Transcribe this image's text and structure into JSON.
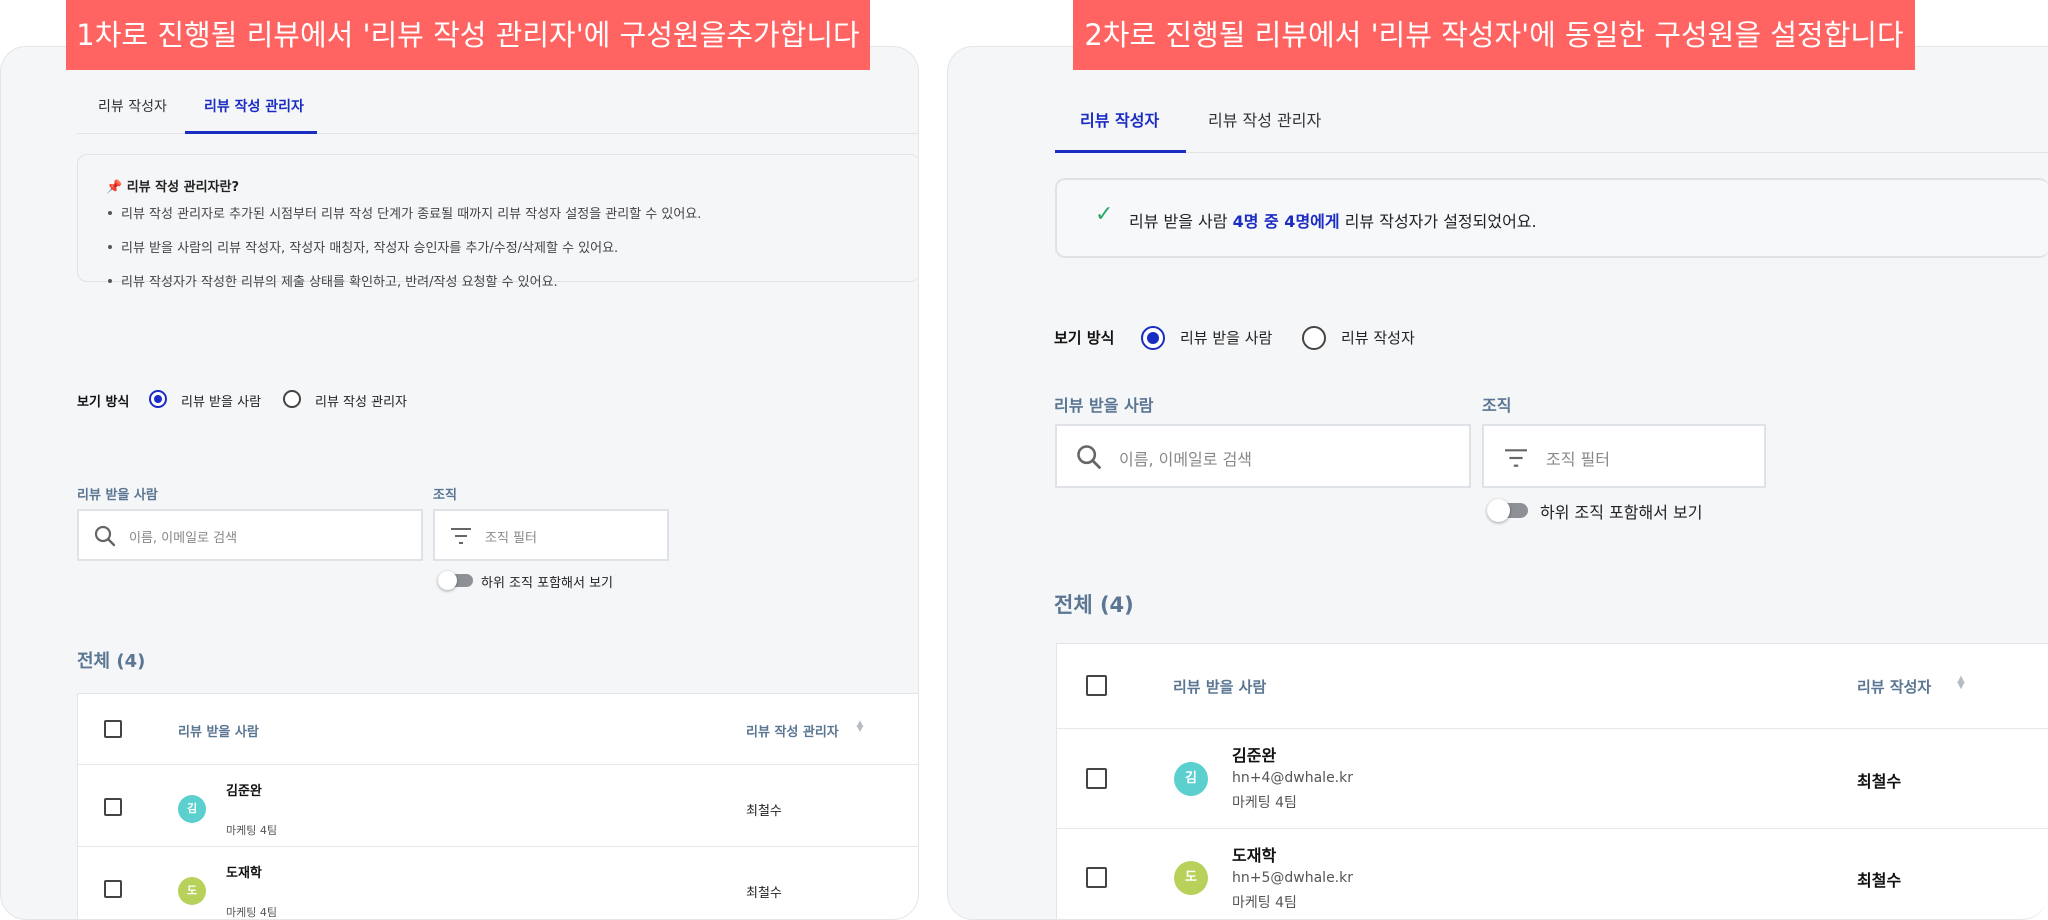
{
  "left": {
    "banner": "1차로 진행될 리뷰에서 '리뷰 작성 관리자'에  구성원을추가합니다",
    "tabs": [
      {
        "label": "리뷰 작성자",
        "active": false
      },
      {
        "label": "리뷰 작성 관리자",
        "active": true
      }
    ],
    "info": {
      "icon": "pushpin-icon",
      "title": "리뷰 작성 관리자란?",
      "lines": [
        "리뷰 작성 관리자로 추가된 시점부터 리뷰 작성 단계가 종료될 때까지 리뷰 작성자 설정을 관리할 수 있어요.",
        "리뷰 받을 사람의 리뷰 작성자, 작성자 매칭자, 작성자 승인자를 추가/수정/삭제할 수 있어요.",
        "리뷰 작성자가 작성한 리뷰의 제출 상태를 확인하고, 반려/작성 요청할 수 있어요."
      ]
    },
    "view_mode": {
      "label": "보기 방식",
      "options": [
        {
          "label": "리뷰 받을 사람",
          "selected": true
        },
        {
          "label": "리뷰 작성 관리자",
          "selected": false
        }
      ]
    },
    "search": {
      "label": "리뷰 받을 사람",
      "placeholder": "이름, 이메일로 검색"
    },
    "org": {
      "label": "조직",
      "placeholder": "조직 필터"
    },
    "toggle": {
      "label": "하위 조직 포함해서 보기",
      "on": false
    },
    "total": "전체 (4)",
    "table": {
      "headers": {
        "reviewee": "리뷰 받을 사람",
        "manager": "리뷰 작성 관리자"
      },
      "rows": [
        {
          "initial": "김",
          "name": "김준완",
          "team": "마케팅 4팀",
          "manager": "최철수",
          "color": "#5ccfcf"
        },
        {
          "initial": "도",
          "name": "도재학",
          "team": "마케팅 4팀",
          "manager": "최철수",
          "color": "#b7d15a"
        }
      ]
    }
  },
  "right": {
    "banner": "2차로 진행될 리뷰에서 '리뷰 작성자'에 동일한 구성원을 설정합니다",
    "tabs": [
      {
        "label": "리뷰 작성자",
        "active": true
      },
      {
        "label": "리뷰 작성 관리자",
        "active": false
      }
    ],
    "status": {
      "icon": "check-icon",
      "prefix": "리뷰 받을 사람",
      "highlight": "4명 중 4명에게",
      "suffix": "리뷰 작성자가 설정되었어요."
    },
    "view_mode": {
      "label": "보기 방식",
      "options": [
        {
          "label": "리뷰 받을 사람",
          "selected": true
        },
        {
          "label": "리뷰 작성자",
          "selected": false
        }
      ]
    },
    "search": {
      "label": "리뷰 받을 사람",
      "placeholder": "이름, 이메일로 검색"
    },
    "org": {
      "label": "조직",
      "placeholder": "조직 필터"
    },
    "toggle": {
      "label": "하위 조직 포함해서 보기",
      "on": false
    },
    "total": "전체 (4)",
    "table": {
      "headers": {
        "reviewee": "리뷰 받을 사람",
        "writer": "리뷰 작성자"
      },
      "rows": [
        {
          "initial": "김",
          "name": "김준완",
          "email": "hn+4@dwhale.kr",
          "team": "마케팅 4팀",
          "writer": "최철수",
          "color": "#5ccfcf"
        },
        {
          "initial": "도",
          "name": "도재학",
          "email": "hn+5@dwhale.kr",
          "team": "마케팅 4팀",
          "writer": "최철수",
          "color": "#b7d15a"
        }
      ]
    }
  }
}
